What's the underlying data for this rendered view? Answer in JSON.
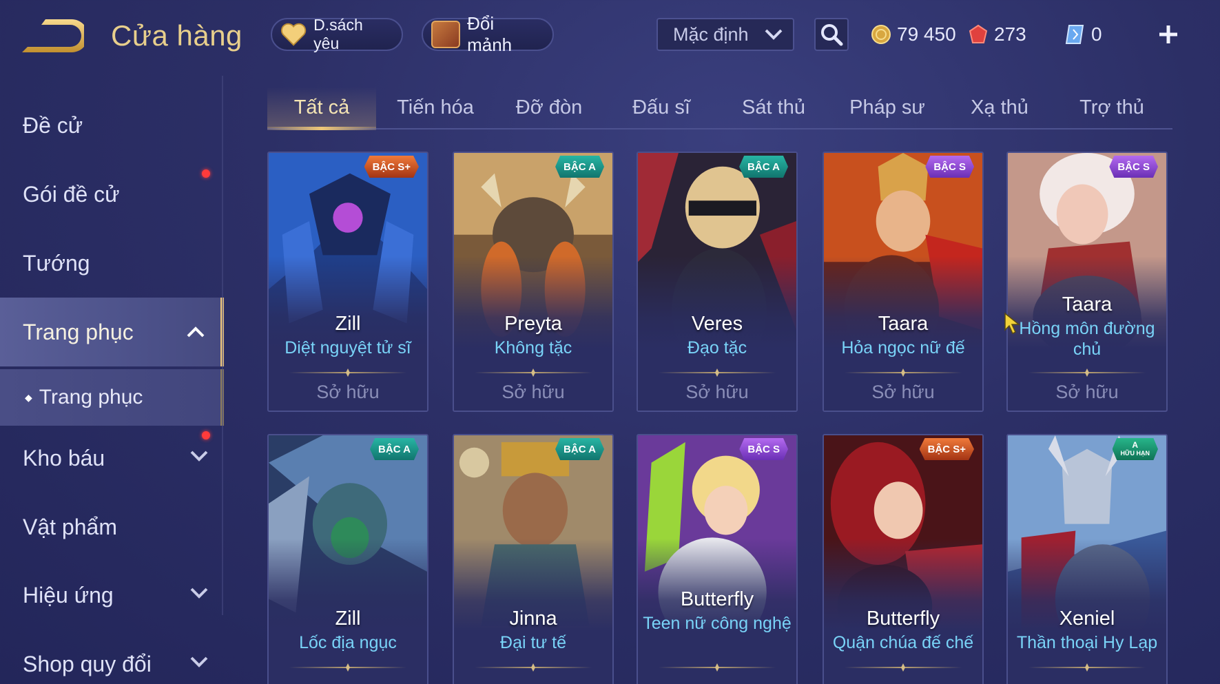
{
  "header": {
    "title": "Cửa hàng",
    "favorites_label": "D.sách yêu",
    "exchange_label": "Đổi mảnh",
    "sort_selected": "Mặc định",
    "currencies": {
      "gold": "79 450",
      "ruby": "273",
      "voucher": "0"
    }
  },
  "sidebar": {
    "items": [
      {
        "label": "Đề cử"
      },
      {
        "label": "Gói đề cử"
      },
      {
        "label": "Tướng"
      },
      {
        "label": "Trang phục"
      },
      {
        "label": "Trang phục"
      },
      {
        "label": "Kho báu"
      },
      {
        "label": "Vật phẩm"
      },
      {
        "label": "Hiệu ứng"
      },
      {
        "label": "Shop quy đổi"
      }
    ]
  },
  "tabs": [
    "Tất cả",
    "Tiến hóa",
    "Đỡ đòn",
    "Đấu sĩ",
    "Sát thủ",
    "Pháp sư",
    "Xạ thủ",
    "Trợ thủ"
  ],
  "cards": [
    {
      "hero": "Zill",
      "skin": "Diệt nguyệt tử sĩ",
      "status": "Sở hữu",
      "badge": "BẬC S+"
    },
    {
      "hero": "Preyta",
      "skin": "Không tặc",
      "status": "Sở hữu",
      "badge": "BẬC A"
    },
    {
      "hero": "Veres",
      "skin": "Đạo tặc",
      "status": "Sở hữu",
      "badge": "BẬC A"
    },
    {
      "hero": "Taara",
      "skin": "Hỏa ngọc nữ đế",
      "status": "Sở hữu",
      "badge": "BẬC S"
    },
    {
      "hero": "Taara",
      "skin": "Hồng môn đường chủ",
      "status": "Sở hữu",
      "badge": "BẬC S"
    },
    {
      "hero": "Zill",
      "skin": "Lốc địa ngục",
      "status": "",
      "badge": "BẬC A"
    },
    {
      "hero": "Jinna",
      "skin": "Đại tư tế",
      "status": "",
      "badge": "BẬC A"
    },
    {
      "hero": "Butterfly",
      "skin": "Teen nữ công nghệ",
      "status": "",
      "badge": "BẬC S"
    },
    {
      "hero": "Butterfly",
      "skin": "Quận chúa đế chế",
      "status": "",
      "badge": "BẬC S+"
    },
    {
      "hero": "Xeniel",
      "skin": "Thần thoại Hy Lạp",
      "status": "",
      "badge": "A",
      "badge_sub": "HỮU HẠN"
    }
  ],
  "colors": {
    "accent_gold": "#e8cf8c",
    "skin_name": "#79d3f7",
    "background": "#2c2f66"
  }
}
